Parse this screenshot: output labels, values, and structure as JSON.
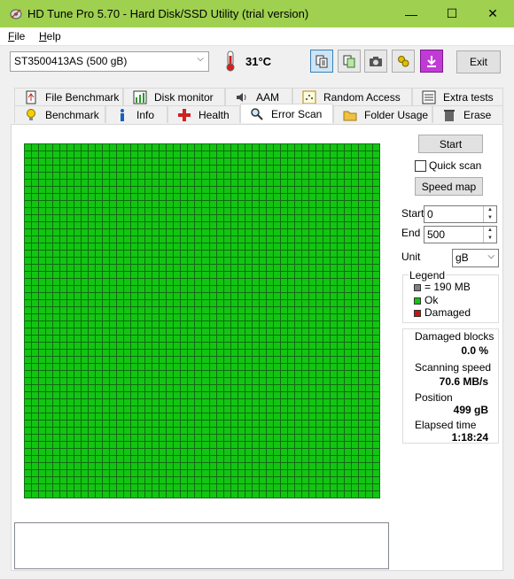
{
  "window": {
    "title": "HD Tune Pro 5.70 - Hard Disk/SSD Utility (trial version)",
    "minimize_glyph": "—",
    "maximize_glyph": "☐",
    "close_glyph": "✕"
  },
  "menu": [
    {
      "label": "File",
      "accel": "F",
      "rest": "ile"
    },
    {
      "label": "Help",
      "accel": "H",
      "rest": "elp"
    }
  ],
  "toolbar": {
    "drive": "ST3500413AS (500 gB)",
    "temperature": "31°C",
    "exit_label": "Exit",
    "icons": [
      "copy-text-icon",
      "copy-screenshot-icon",
      "camera-icon",
      "options-icon",
      "save-icon"
    ]
  },
  "tabs": {
    "row1": [
      "File Benchmark",
      "Disk monitor",
      "AAM",
      "Random Access",
      "Extra tests"
    ],
    "row2": [
      "Benchmark",
      "Info",
      "Health",
      "Error Scan",
      "Folder Usage",
      "Erase"
    ],
    "active": "Error Scan"
  },
  "scan": {
    "grid_columns": 50,
    "grid_rows": 50,
    "block_status": "Ok",
    "block_color": "#12c512"
  },
  "controls": {
    "start_button": "Start",
    "quick_scan_label": "Quick scan",
    "quick_scan_checked": false,
    "speed_map_button": "Speed map",
    "start_label": "Start",
    "start_value": "0",
    "end_label": "End",
    "end_value": "500",
    "unit_label": "Unit",
    "unit_value": "gB"
  },
  "legend": {
    "title": "Legend",
    "items": [
      {
        "text": "= 190 MB",
        "color": "#808080"
      },
      {
        "text": "Ok",
        "color": "#12c512"
      },
      {
        "text": "Damaged",
        "color": "#d01010"
      }
    ]
  },
  "stats": {
    "damaged_blocks_label": "Damaged blocks",
    "damaged_blocks_value": "0.0 %",
    "scanning_speed_label": "Scanning speed",
    "scanning_speed_value": "70.6 MB/s",
    "position_label": "Position",
    "position_value": "499 gB",
    "elapsed_label": "Elapsed time",
    "elapsed_value": "1:18:24"
  }
}
